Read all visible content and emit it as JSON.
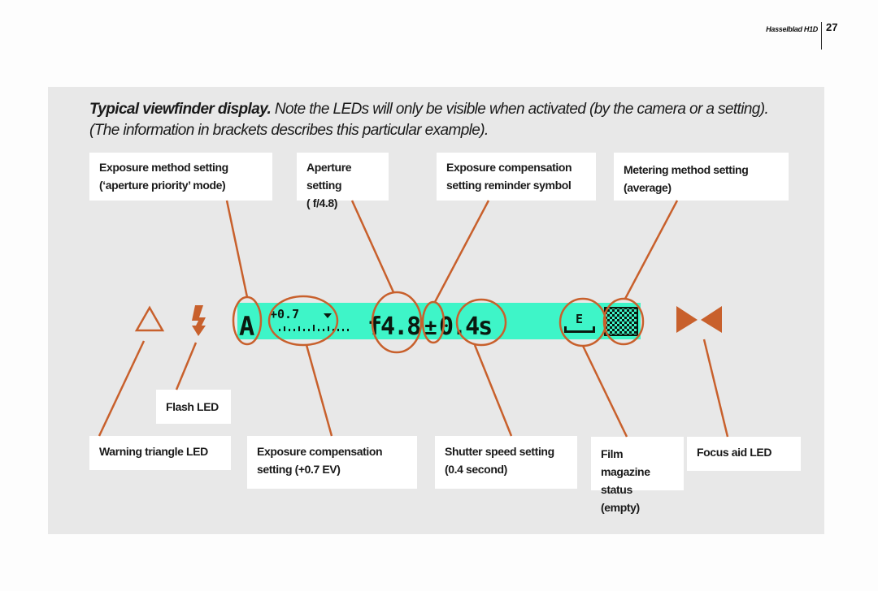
{
  "header": {
    "book_title": "Hasselblad H1D",
    "page_number": "27"
  },
  "caption": {
    "bold": "Typical viewfinder display.",
    "text1": " Note the LEDs will only be visible when activated (by the camera or a setting).",
    "text2": "(The information in brackets describes this particular example)."
  },
  "labels": {
    "exposure_method": [
      "Exposure method setting",
      "(‘aperture priority’ mode)"
    ],
    "aperture": [
      "Aperture setting",
      "( f/4.8)"
    ],
    "exp_comp_symbol": [
      "Exposure compensation",
      "setting reminder symbol"
    ],
    "metering": [
      "Metering method setting",
      "(average)"
    ],
    "flash": [
      "Flash LED"
    ],
    "warning": [
      "Warning triangle LED"
    ],
    "exp_comp_setting": [
      "Exposure compensation",
      "setting (+0.7 EV)"
    ],
    "shutter": [
      "Shutter speed setting",
      "(0.4 second)"
    ],
    "film_magazine": [
      "Film magazine",
      "status (empty)"
    ],
    "focus_aid": [
      "Focus aid LED"
    ]
  },
  "display": {
    "mode": "A",
    "exp_comp": "+0.7",
    "aperture": "f4.8",
    "comp_symbol": "±",
    "shutter": "0.4s",
    "magazine": "E"
  },
  "colors": {
    "accent": "#c8602c",
    "lcd": "#3ef5c8",
    "panel": "#e8e8e8"
  },
  "icons": {
    "warning": "warning-triangle-icon",
    "flash": "flash-bolt-icon",
    "focus": "focus-aid-icon"
  }
}
